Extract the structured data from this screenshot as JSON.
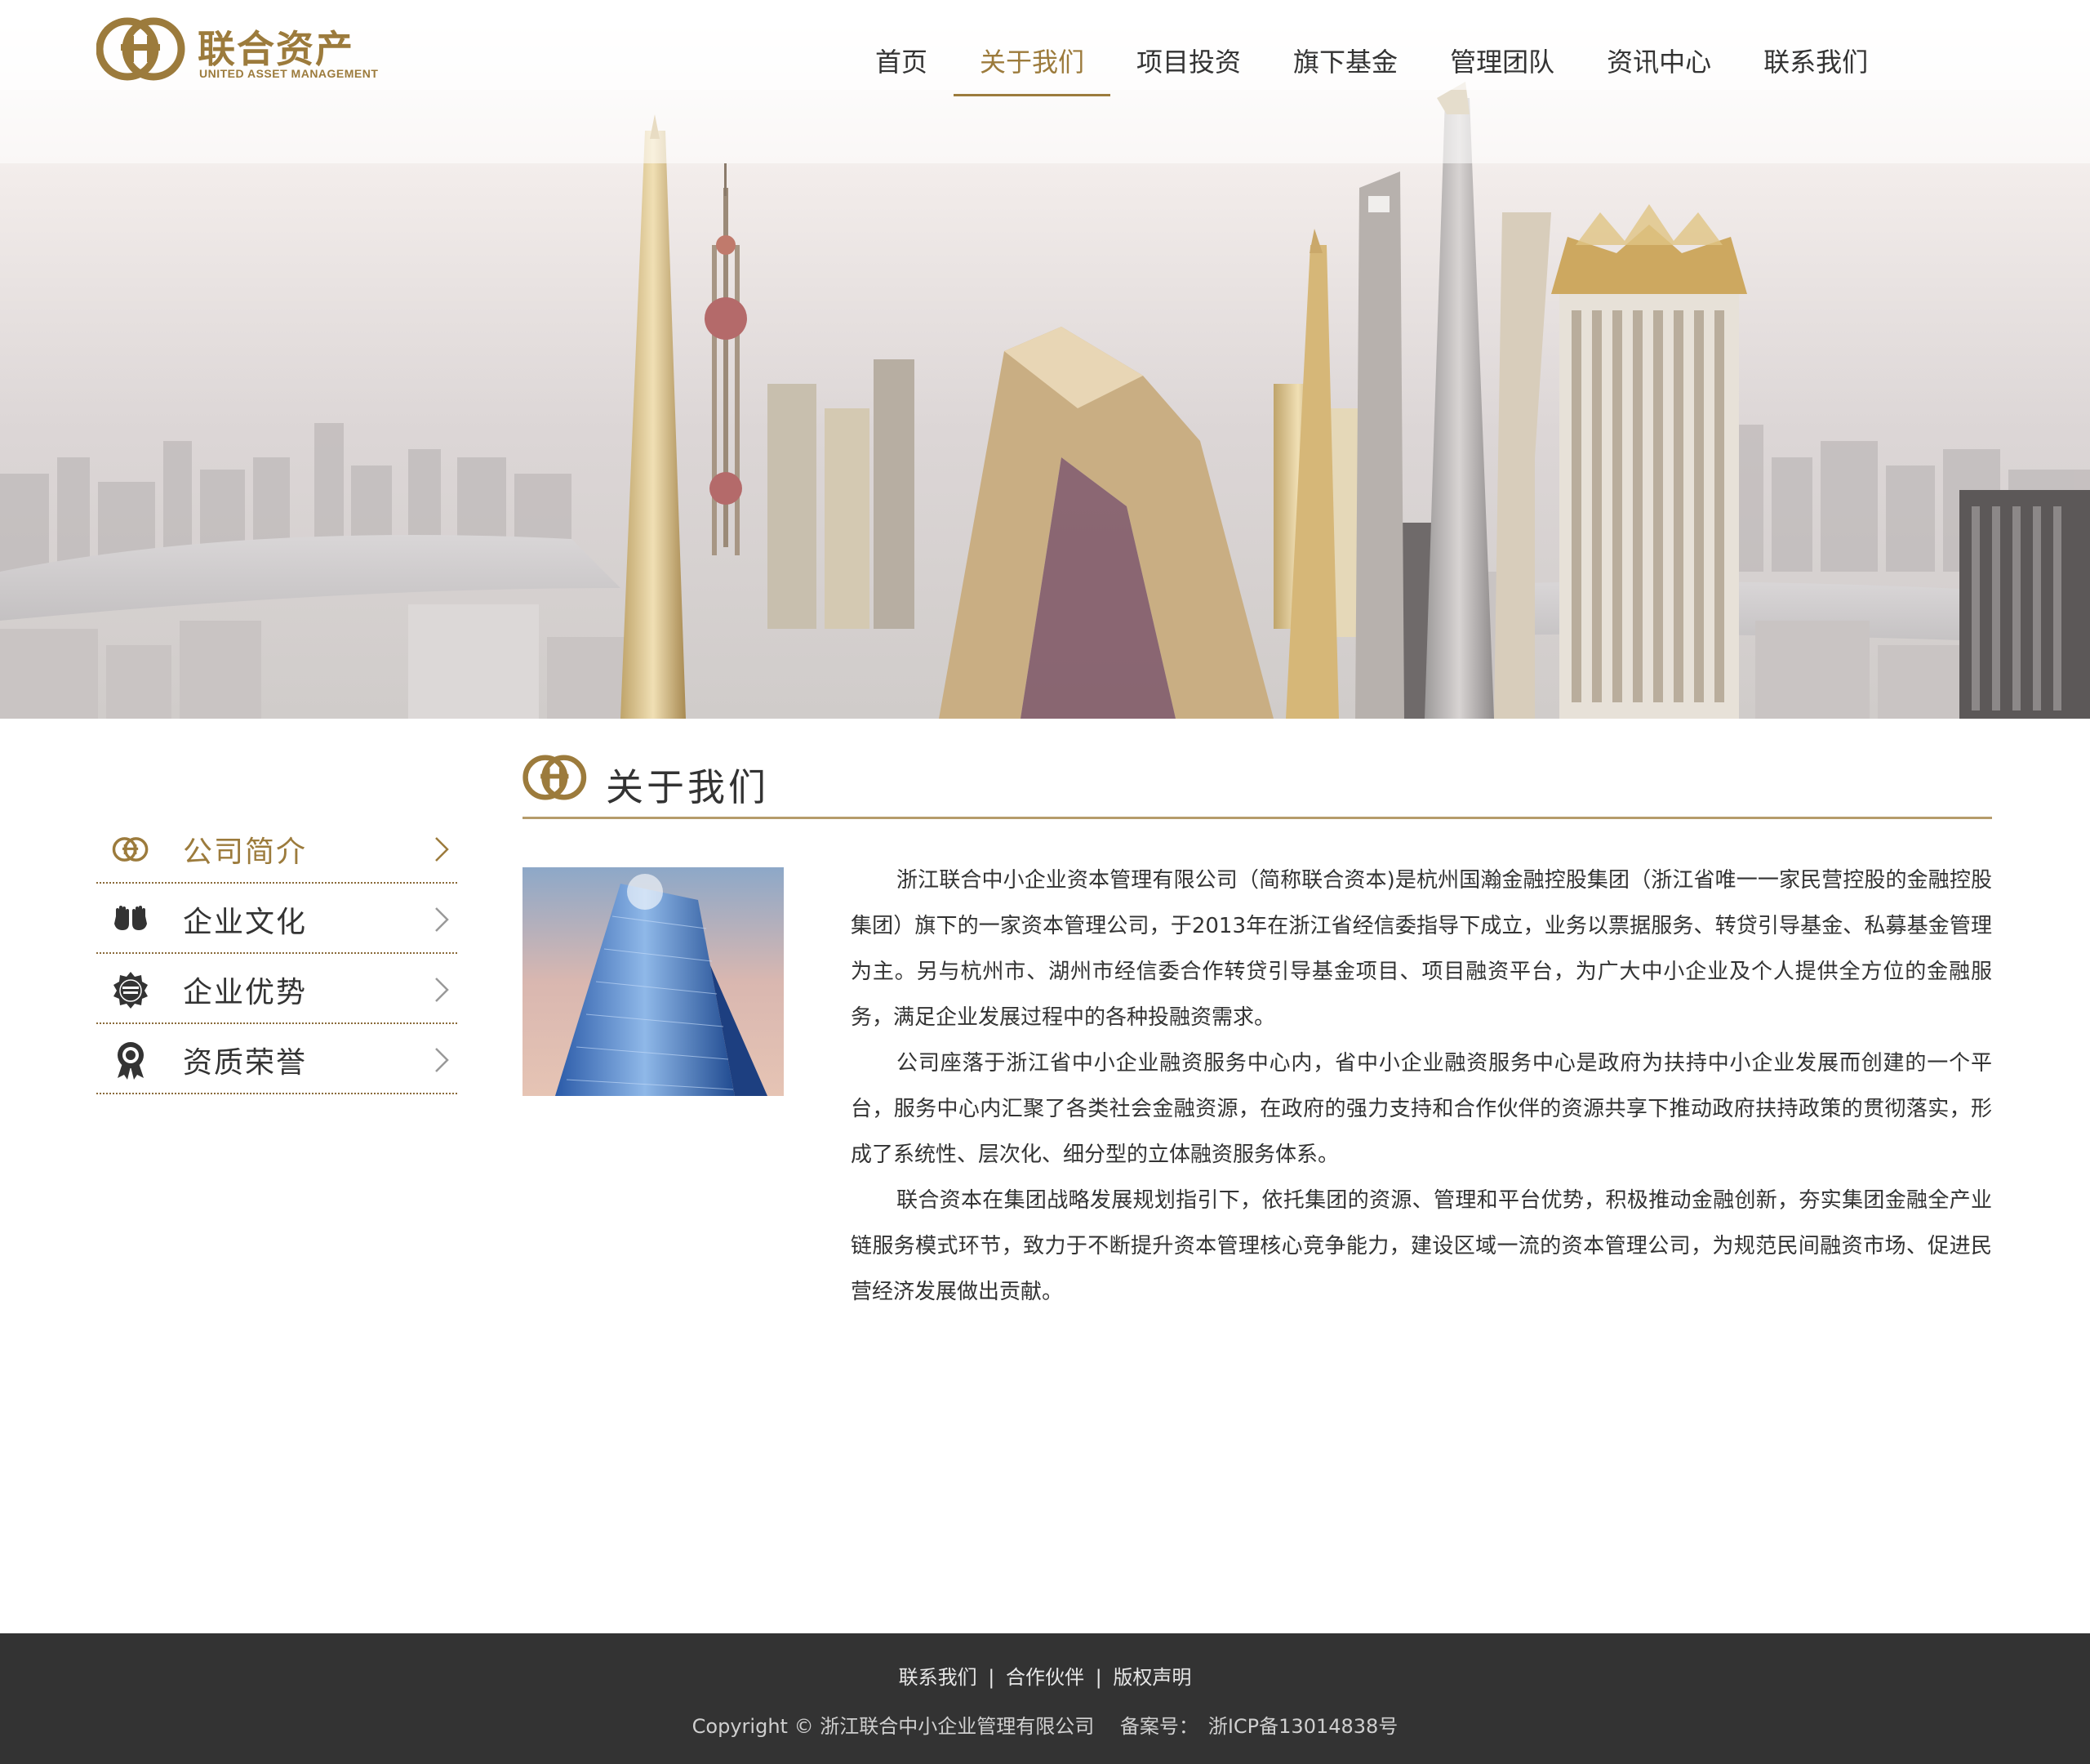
{
  "brand": {
    "name_cn": "联合资产",
    "name_en": "UNITED ASSET MANAGEMENT",
    "color": "#9c7b3c"
  },
  "nav": {
    "items": [
      {
        "label": "首页",
        "active": false
      },
      {
        "label": "关于我们",
        "active": true
      },
      {
        "label": "项目投资",
        "active": false
      },
      {
        "label": "旗下基金",
        "active": false
      },
      {
        "label": "管理团队",
        "active": false
      },
      {
        "label": "资讯中心",
        "active": false
      },
      {
        "label": "联系我们",
        "active": false
      }
    ]
  },
  "section": {
    "title": "关于我们",
    "icon": "brand-coin-icon"
  },
  "sidebar": {
    "items": [
      {
        "label": "公司简介",
        "icon": "brand-coin-icon",
        "active": true
      },
      {
        "label": "企业文化",
        "icon": "hands-icon",
        "active": false
      },
      {
        "label": "企业优势",
        "icon": "best-choice-badge-icon",
        "active": false
      },
      {
        "label": "资质荣誉",
        "icon": "award-ribbon-icon",
        "active": false
      }
    ]
  },
  "content": {
    "paragraphs": [
      "浙江联合中小企业资本管理有限公司（简称联合资本)是杭州国瀚金融控股集团（浙江省唯一一家民营控股的金融控股集团）旗下的一家资本管理公司，于2013年在浙江省经信委指导下成立，业务以票据服务、转贷引导基金、私募基金管理为主。另与杭州市、湖州市经信委合作转贷引导基金项目、项目融资平台，为广大中小企业及个人提供全方位的金融服务，满足企业发展过程中的各种投融资需求。",
      "公司座落于浙江省中小企业融资服务中心内，省中小企业融资服务中心是政府为扶持中小企业发展而创建的一个平台，服务中心内汇聚了各类社会金融资源，在政府的强力支持和合作伙伴的资源共享下推动政府扶持政策的贯彻落实，形成了系统性、层次化、细分型的立体融资服务体系。",
      "联合资本在集团战略发展规划指引下，依托集团的资源、管理和平台优势，积极推动金融创新，夯实集团金融全产业链服务模式环节，致力于不断提升资本管理核心竞争能力，建设区域一流的资本管理公司，为规范民间融资市场、促进民营经济发展做出贡献。"
    ]
  },
  "footer": {
    "links": [
      "联系我们",
      "合作伙伴",
      "版权声明"
    ],
    "separator": "|",
    "copyright": "Copyright © 浙江联合中小企业管理有限公司",
    "icp_label": "备案号：",
    "icp_number": "浙ICP备13014838号"
  },
  "colors": {
    "accent": "#9c7b3c",
    "footer_bg": "#333333",
    "text": "#333333"
  }
}
